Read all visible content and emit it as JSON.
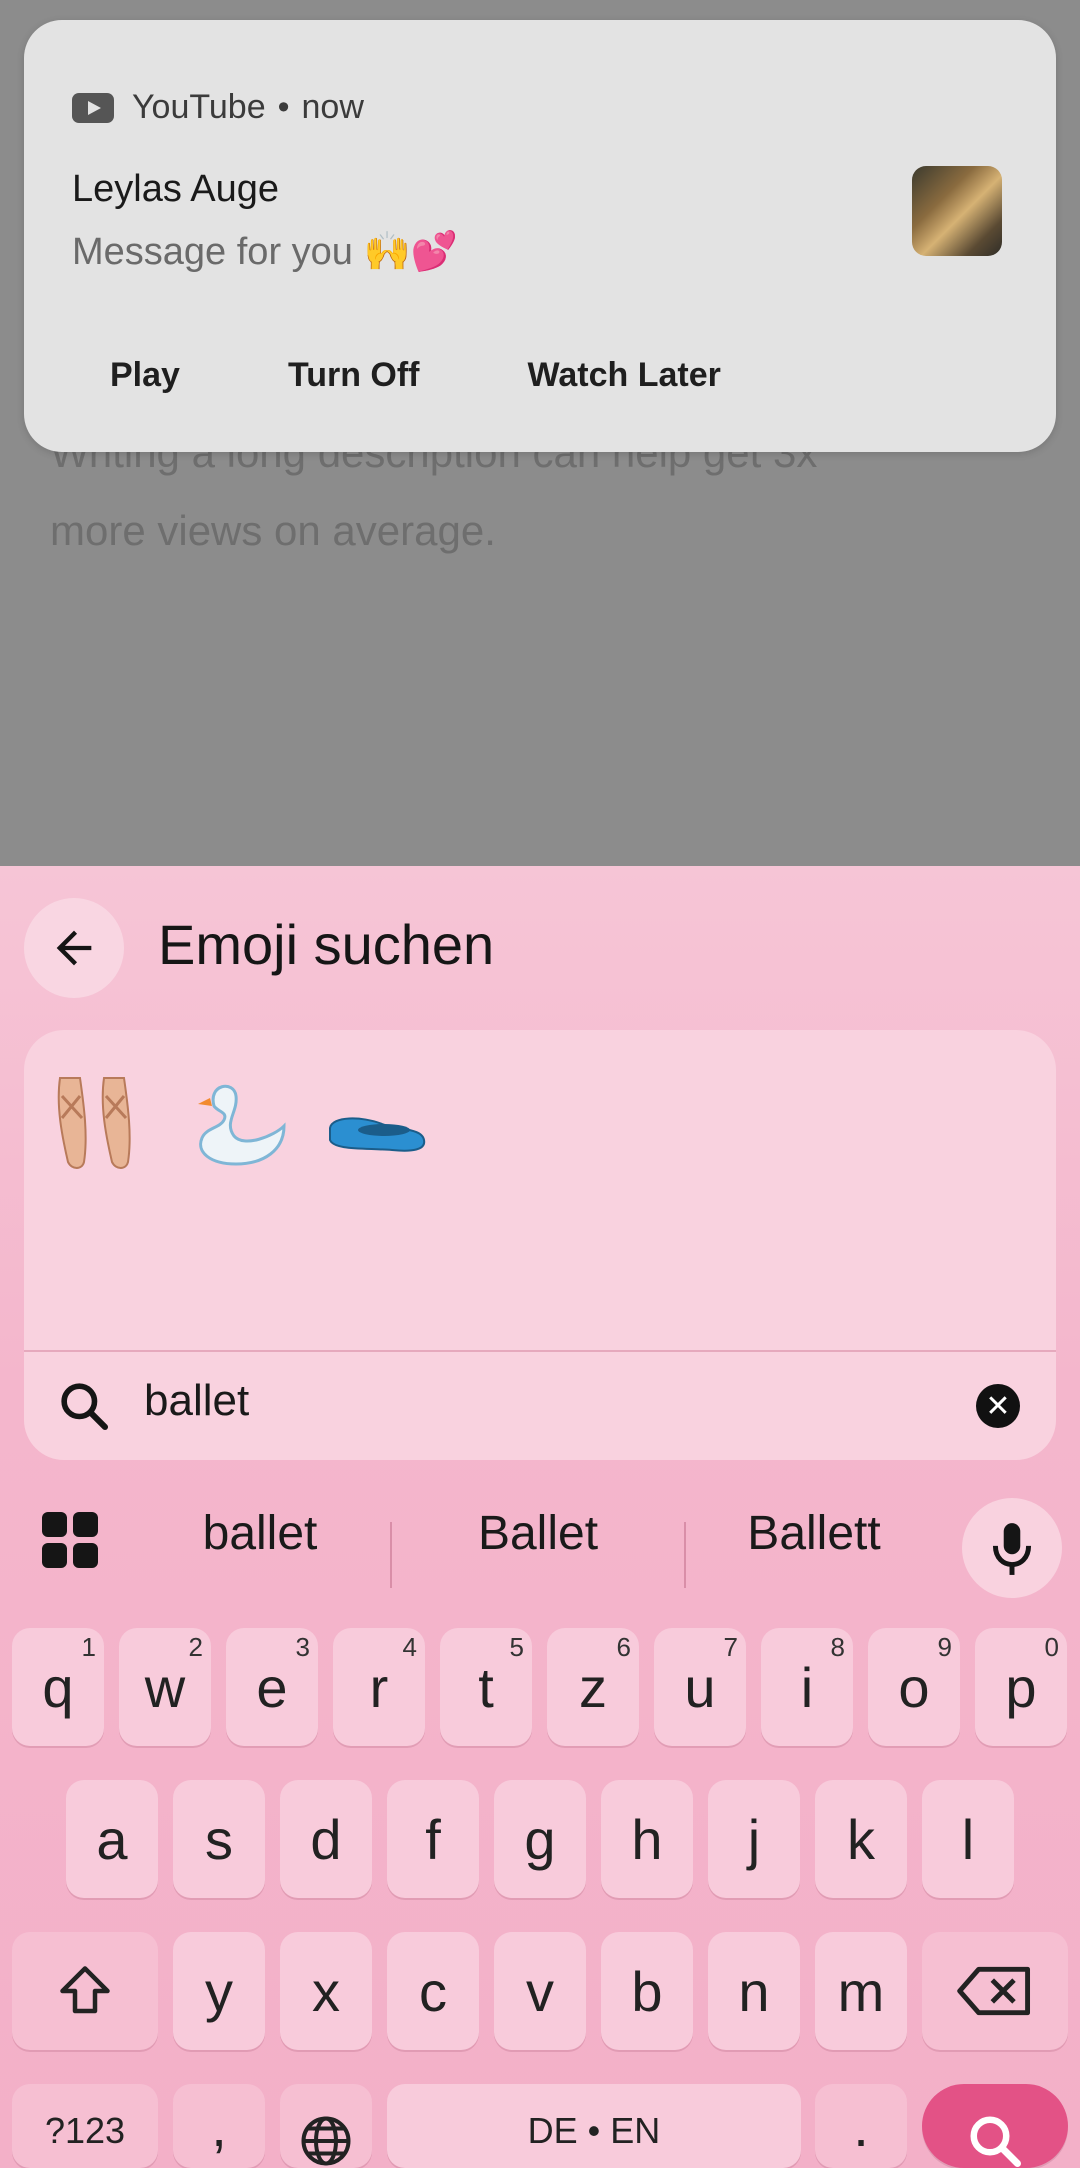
{
  "background": {
    "line1": "Writing a long description can help get 3x",
    "line2": "more views on average."
  },
  "notification": {
    "app": "YouTube",
    "separator": "•",
    "time": "now",
    "title": "Leylas Auge",
    "message": "Message for you 🙌💕",
    "actions": [
      "Play",
      "Turn Off",
      "Watch Later"
    ]
  },
  "emoji_search": {
    "title": "Emoji suchen",
    "results": [
      "ballet-shoes",
      "swan",
      "flat-shoe"
    ],
    "query": "ballet"
  },
  "suggestions": [
    "ballet",
    "Ballet",
    "Ballett"
  ],
  "keyboard": {
    "row1": [
      {
        "key": "q",
        "hint": "1"
      },
      {
        "key": "w",
        "hint": "2"
      },
      {
        "key": "e",
        "hint": "3"
      },
      {
        "key": "r",
        "hint": "4"
      },
      {
        "key": "t",
        "hint": "5"
      },
      {
        "key": "z",
        "hint": "6"
      },
      {
        "key": "u",
        "hint": "7"
      },
      {
        "key": "i",
        "hint": "8"
      },
      {
        "key": "o",
        "hint": "9"
      },
      {
        "key": "p",
        "hint": "0"
      }
    ],
    "row2": [
      "a",
      "s",
      "d",
      "f",
      "g",
      "h",
      "j",
      "k",
      "l"
    ],
    "row3": [
      "y",
      "x",
      "c",
      "v",
      "b",
      "n",
      "m"
    ],
    "symbols_label": "?123",
    "comma": ",",
    "space_label": "DE • EN",
    "period": "."
  },
  "colors": {
    "keyboard_bg": "#f4b6cc",
    "key_bg": "#f8cbdb",
    "enter_bg": "#e35286",
    "notification_bg": "#e3e3e3"
  }
}
